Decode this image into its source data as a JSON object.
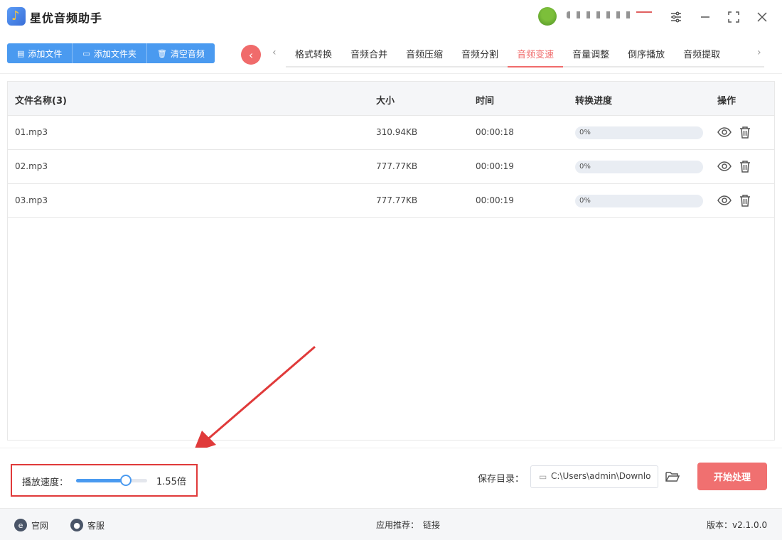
{
  "app": {
    "title": "星优音频助手"
  },
  "window_controls": [
    "settings",
    "minimize",
    "maximize",
    "close"
  ],
  "toolbar": {
    "buttons": [
      {
        "label": "添加文件",
        "icon": "file-icon"
      },
      {
        "label": "添加文件夹",
        "icon": "folder-icon"
      },
      {
        "label": "清空音频",
        "icon": "trash-icon"
      }
    ]
  },
  "tabs": {
    "items": [
      "格式转换",
      "音频合并",
      "音频压缩",
      "音频分割",
      "音频变速",
      "音量调整",
      "倒序播放",
      "音频提取"
    ],
    "active": "音频变速"
  },
  "table": {
    "headers": {
      "name": "文件名称(3)",
      "size": "大小",
      "time": "时间",
      "progress": "转换进度",
      "actions": "操作"
    },
    "rows": [
      {
        "name": "01.mp3",
        "size": "310.94KB",
        "time": "00:00:18",
        "progress_text": "0%",
        "progress": 0
      },
      {
        "name": "02.mp3",
        "size": "777.77KB",
        "time": "00:00:19",
        "progress_text": "0%",
        "progress": 0
      },
      {
        "name": "03.mp3",
        "size": "777.77KB",
        "time": "00:00:19",
        "progress_text": "0%",
        "progress": 0
      }
    ]
  },
  "settings": {
    "speed_label": "播放速度：",
    "speed_value_text": "1.55倍",
    "speed_fraction": 0.7,
    "save_label": "保存目录：",
    "save_path": "C:\\Users\\admin\\Downlo",
    "start_button": "开始处理"
  },
  "footer": {
    "website": "官网",
    "support": "客服",
    "recommend_label": "应用推荐：",
    "recommend_link": "链接",
    "version": "版本：v2.1.0.0"
  },
  "colors": {
    "accent": "#4a9af0",
    "highlight": "#f06b6b",
    "annotation": "#e03a3a"
  }
}
